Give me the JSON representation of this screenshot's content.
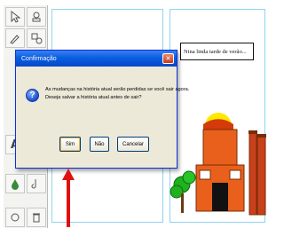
{
  "dialog": {
    "title": "Confirmação",
    "close_glyph": "×",
    "message_line1": "As mudanças na história atual serão perdidas se você sair agora.",
    "message_line2": "Deseja salvar a história atual antes de sair?",
    "icon": "question-icon",
    "buttons": {
      "yes": "Sim",
      "no": "Não",
      "cancel": "Cancelar"
    }
  },
  "story": {
    "text_box": "Nina linda tarde de verão..."
  },
  "toolbox": {
    "text_tool_label": "A"
  },
  "colors": {
    "titlebar": "#0a5ee0",
    "dialog_bg": "#ece9d8",
    "arrow": "#e01010",
    "barn": "#e8601c",
    "sun": "#ffe800",
    "tree": "#20b020"
  }
}
